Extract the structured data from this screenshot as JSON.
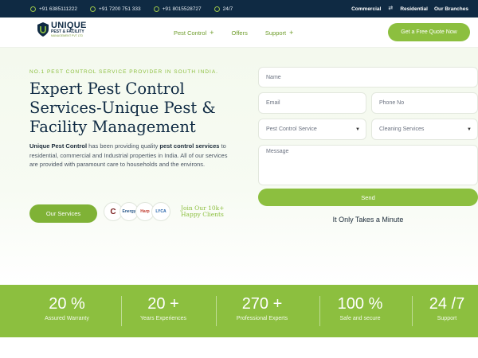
{
  "topbar": {
    "phones": [
      "+91 6385111222",
      "+91 7200 751 333",
      "+91 8015528727"
    ],
    "hours": "24/7",
    "links": [
      "Commercial",
      "Residential",
      "Our Branches"
    ]
  },
  "logo": {
    "line1": "UNIQUE",
    "line2": "PEST & FACILITY",
    "line3": "MANAGEMENT PVT LTD"
  },
  "nav": {
    "items": [
      "Pest Control",
      "Offers",
      "Support"
    ],
    "quote_button": "Get a Free Quote Now"
  },
  "hero": {
    "eyebrow": "NO.1 PEST CONTROL SERVICE PROVIDER IN SOUTH INDIA.",
    "headline": "Expert Pest Control Services-Unique Pest & Facility Management",
    "desc_brand": "Unique Pest Control",
    "desc_part1": " has been providing quality ",
    "desc_bold": "pest control services",
    "desc_part2": " to residential, commercial and Industrial properties in India. All of our services are provided with paramount care to households and the environs.",
    "services_button": "Our Services",
    "clients": [
      "C",
      "Energy",
      "Harp",
      "LYCA"
    ],
    "join_line1": "Join Our 10k+",
    "join_line2": "Happy Clients"
  },
  "form": {
    "name_placeholder": "Name",
    "email_placeholder": "Email",
    "phone_placeholder": "Phone No",
    "pest_select": "Pest Control Service",
    "clean_select": "Cleaning Services",
    "message_placeholder": "Message",
    "send_button": "Send",
    "tagline": "It Only Takes a Minute"
  },
  "stats": [
    {
      "num": "20 %",
      "label": "Assured Warranty"
    },
    {
      "num": "20 +",
      "label": "Years Experiences"
    },
    {
      "num": "270 +",
      "label": "Professional Experts"
    },
    {
      "num": "100 %",
      "label": "Safe and secure"
    },
    {
      "num": "24 /7",
      "label": "Support"
    }
  ],
  "colors": {
    "accent": "#8cbf3f",
    "navy": "#0f2a43"
  }
}
